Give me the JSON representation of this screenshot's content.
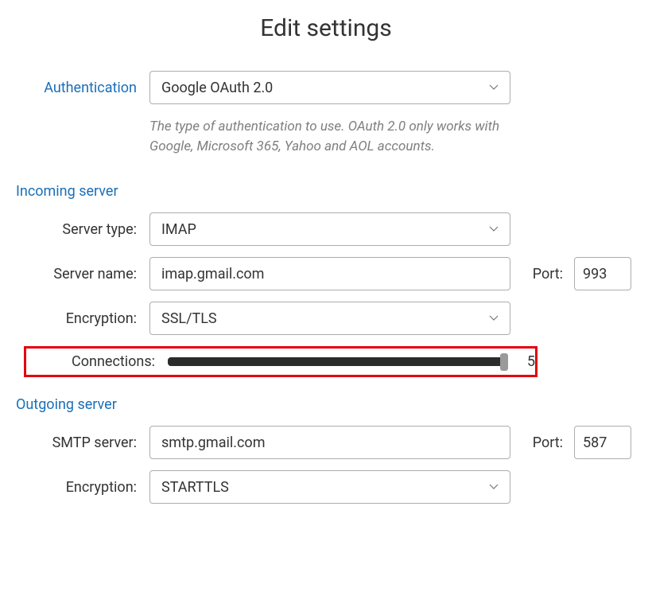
{
  "title": "Edit settings",
  "auth": {
    "label": "Authentication",
    "selected": "Google OAuth 2.0",
    "help": "The type of authentication to use. OAuth 2.0 only works with Google, Microsoft 365, Yahoo and AOL accounts."
  },
  "incoming": {
    "header": "Incoming server",
    "server_type_label": "Server type:",
    "server_type": "IMAP",
    "server_name_label": "Server name:",
    "server_name": "imap.gmail.com",
    "port_label": "Port:",
    "port": "993",
    "encryption_label": "Encryption:",
    "encryption": "SSL/TLS",
    "connections_label": "Connections:",
    "connections_value": "5"
  },
  "outgoing": {
    "header": "Outgoing server",
    "smtp_server_label": "SMTP server:",
    "smtp_server": "smtp.gmail.com",
    "port_label": "Port:",
    "port": "587",
    "encryption_label": "Encryption:",
    "encryption": "STARTTLS"
  }
}
